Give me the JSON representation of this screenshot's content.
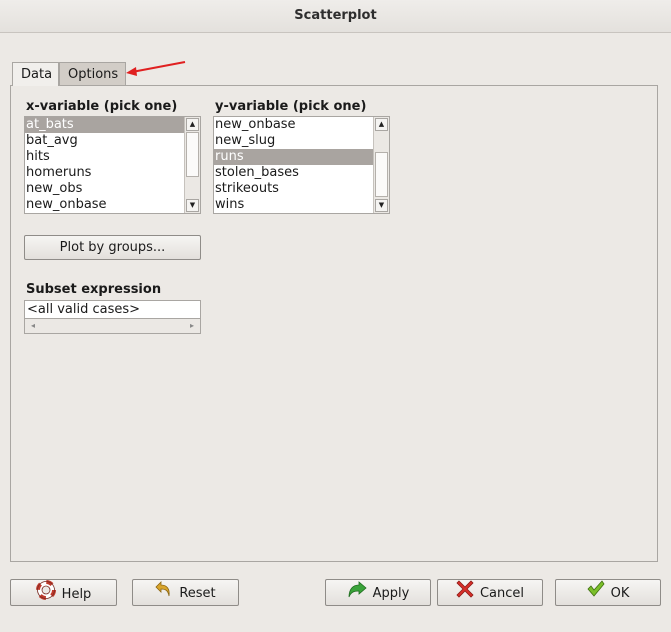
{
  "window": {
    "title": "Scatterplot"
  },
  "tabs": [
    {
      "label": "Data"
    },
    {
      "label": "Options"
    }
  ],
  "x_variable": {
    "label": "x-variable (pick one)",
    "items": [
      "at_bats",
      "bat_avg",
      "hits",
      "homeruns",
      "new_obs",
      "new_onbase"
    ],
    "selected": "at_bats"
  },
  "y_variable": {
    "label": "y-variable (pick one)",
    "items": [
      "new_onbase",
      "new_slug",
      "runs",
      "stolen_bases",
      "strikeouts",
      "wins"
    ],
    "selected": "runs"
  },
  "plot_by_groups": {
    "label": "Plot by groups..."
  },
  "subset": {
    "label": "Subset expression",
    "value": "<all valid cases>"
  },
  "buttons": {
    "help": "Help",
    "reset": "Reset",
    "apply": "Apply",
    "cancel": "Cancel",
    "ok": "OK"
  },
  "annotation": {
    "color": "#e02020",
    "icon": "arrow-annotation-icon"
  }
}
